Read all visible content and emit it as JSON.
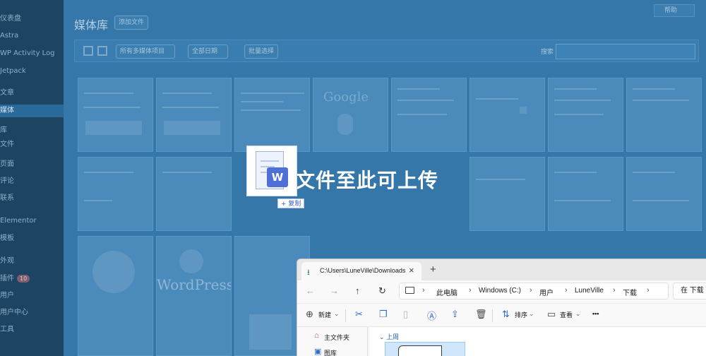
{
  "wp": {
    "sidebar": [
      "仪表盘",
      "Astra",
      "WP Activity Log",
      "Jetpack",
      "文章",
      "媒体",
      "库",
      "文件",
      "页面",
      "评论",
      "联系",
      "Elementor",
      "模板",
      "外观",
      "插件",
      "用户",
      "用户中心",
      "工具"
    ],
    "plugins_badge": "10",
    "help": "帮助",
    "title": "媒体库",
    "add_file": "添加文件",
    "filter_type": "所有多媒体项目",
    "filter_date": "全部日期",
    "bulk_select": "批量选择",
    "search_label": "搜索"
  },
  "thumbs": {
    "google": "Google",
    "wordpress": "WordPress"
  },
  "drag": {
    "drop_text": "文件至此可上传",
    "doc_letter": "W",
    "copy_badge": "+ 复制"
  },
  "explorer": {
    "tab_label": "C:\\Users\\LuneVille\\Downloads",
    "tab_close": "×",
    "tab_add": "+",
    "nav": {
      "back": "←",
      "forward": "→",
      "up": "↑",
      "refresh": "↻"
    },
    "breadcrumb": [
      "此电脑",
      "Windows (C:)",
      "用户",
      "LuneVille",
      "下载"
    ],
    "search_placeholder": "在 下载 中",
    "cmd": {
      "new": "新建",
      "sort": "排序",
      "view": "查看",
      "more": "•••"
    },
    "navpane": [
      "主文件夹",
      "图库"
    ],
    "group": "上周"
  },
  "colors": {
    "overlay": "#2f6e9d",
    "accent": "#2b6cc8",
    "selection": "#cfe6fb"
  }
}
